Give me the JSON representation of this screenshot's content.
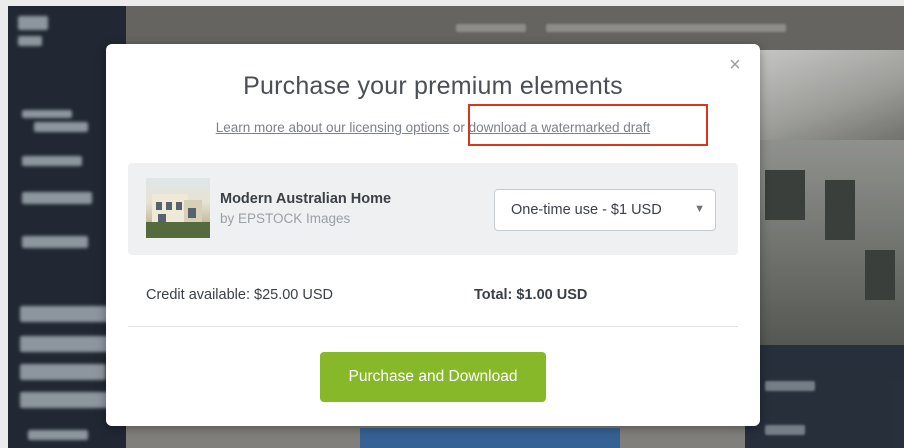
{
  "modal": {
    "title": "Purchase your premium elements",
    "close_icon": "close-icon",
    "links": {
      "licensing": "Learn more about our licensing options",
      "separator": " or ",
      "watermarked": "download a watermarked draft"
    },
    "highlight_color": "#d9361c",
    "item": {
      "thumbnail_icon": "house-thumbnail",
      "name": "Modern Australian Home",
      "byline": "by EPSTOCK Images",
      "license": {
        "selected": "One-time use - $1 USD",
        "arrow_icon": "dropdown-arrow-icon"
      }
    },
    "credit": "Credit available: $25.00 USD",
    "total": "Total: $1.00 USD",
    "purchase_button": "Purchase and Download",
    "accent_color": "#86b82a"
  }
}
